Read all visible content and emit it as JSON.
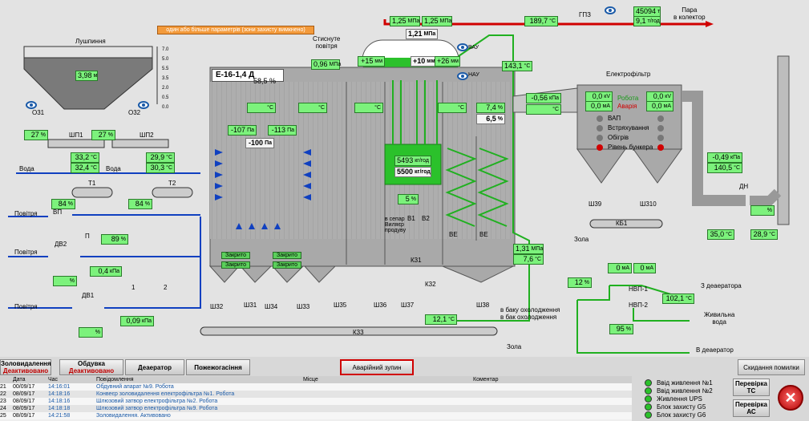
{
  "alerts": {
    "param_warning": "один або більше параметрів (зони захисту вимкнено)"
  },
  "header": {
    "steam_out": "Пара\nв колектор",
    "gpz": "ГПЗ",
    "compressed_air": "Стиснуте\nповітря",
    "electrofilter": "Електрофільтр",
    "husk": "Лушпиння",
    "boiler_name": "Е-16-1,4 Д"
  },
  "values": {
    "p_top1": {
      "v": "1,25",
      "u": "МПа"
    },
    "p_top2": {
      "v": "1,25",
      "u": "МПа"
    },
    "t_top": {
      "v": "189,7",
      "u": "°C"
    },
    "drum_p": {
      "v": "1,21",
      "u": "МПа"
    },
    "flow1": {
      "v": "45094",
      "u": "т"
    },
    "flow2": {
      "v": "9,1",
      "u": "т/год"
    },
    "air_p": {
      "v": "0,96",
      "u": "МПа"
    },
    "hopper_lvl": {
      "v": "3,98",
      "u": "м"
    },
    "drum_left": {
      "v": "+15",
      "u": "мм"
    },
    "drum_mid": {
      "v": "+10",
      "u": "мм"
    },
    "drum_right": {
      "v": "+26",
      "u": "мм"
    },
    "t_143": {
      "v": "143,1",
      "u": "°C"
    },
    "boiler_pct": {
      "v": "58,5",
      "u": "%"
    },
    "furnace_t1": {
      "v": "",
      "u": "°C"
    },
    "furnace_t2": {
      "v": "",
      "u": "°C"
    },
    "furnace_t3": {
      "v": "",
      "u": "°C"
    },
    "furnace_t4": {
      "v": "",
      "u": "°C"
    },
    "o2": {
      "v": "7,4",
      "u": "%"
    },
    "co2": {
      "v": "6,5",
      "u": "%"
    },
    "draft1": {
      "v": "-107",
      "u": "Па"
    },
    "draft2": {
      "v": "-113",
      "u": "Па"
    },
    "draft3": {
      "v": "-100",
      "u": "Па"
    },
    "ef_p": {
      "v": "-0,56",
      "u": "кПа"
    },
    "ef_t": {
      "v": "",
      "u": "°C"
    },
    "ef1_kv": {
      "v": "0,0",
      "u": "кV"
    },
    "ef1_ma": {
      "v": "0,0",
      "u": "мА"
    },
    "ef2_kv": {
      "v": "0,0",
      "u": "кV"
    },
    "ef2_ma": {
      "v": "0,0",
      "u": "мА"
    },
    "dn_p": {
      "v": "-0,49",
      "u": "кПа"
    },
    "dn_t": {
      "v": "140,5",
      "u": "°C"
    },
    "sp1_a": {
      "v": "27",
      "u": "%"
    },
    "sp1_b": {
      "v": "33,2",
      "u": "°C"
    },
    "sp1_c": {
      "v": "32,4",
      "u": "°C"
    },
    "sp2_a": {
      "v": "27",
      "u": "%"
    },
    "sp2_b": {
      "v": "29,9",
      "u": "°C"
    },
    "sp2_c": {
      "v": "30,3",
      "u": "°C"
    },
    "t1_pct": {
      "v": "84",
      "u": "%"
    },
    "t2_pct": {
      "v": "84",
      "u": "%"
    },
    "p_pct": {
      "v": "89",
      "u": "%"
    },
    "dv2_p": {
      "v": "0,4",
      "u": "кПа"
    },
    "dv2_pct": {
      "v": "",
      "u": "%"
    },
    "dv1_pct": {
      "v": "",
      "u": "%"
    },
    "dv1_p": {
      "v": "0,09",
      "u": "кПа"
    },
    "eco_flow1": {
      "v": "5493",
      "u": "кг/год"
    },
    "eco_flow2": {
      "v": "5500",
      "u": "кг/год"
    },
    "sep_pct": {
      "v": "5",
      "u": "%"
    },
    "p_131": {
      "v": "1,31",
      "u": "МПа"
    },
    "t_76": {
      "v": "7,6",
      "u": "°C"
    },
    "k_121": {
      "v": "12,1",
      "u": "°C"
    },
    "nvp_pct": {
      "v": "12",
      "u": "%"
    },
    "nvp_ma1": {
      "v": "0",
      "u": "мА"
    },
    "nvp_ma2": {
      "v": "0",
      "u": "мА"
    },
    "feed_t": {
      "v": "102,1",
      "u": "°C"
    },
    "nvp_95": {
      "v": "95",
      "u": "%"
    },
    "dn_35": {
      "v": "35,0",
      "u": "°C"
    },
    "dn_289": {
      "v": "28,9",
      "u": "°C"
    },
    "dn_pct": {
      "v": "",
      "u": "%"
    }
  },
  "labels": {
    "o31": "О31",
    "o32": "О32",
    "shp1": "ШП1",
    "shp2": "ШП2",
    "voda1": "Вода",
    "voda2": "Вода",
    "t1": "Т1",
    "t2": "Т2",
    "povitrya1": "Повітря",
    "vp": "ВП",
    "p": "П",
    "dv2": "ДВ2",
    "povitrya2": "Повітря",
    "dv1": "ДВ1",
    "povitrya3": "Повітря",
    "n1": "1",
    "n2": "2",
    "vap": "ВАП",
    "vstr": "Встряхування",
    "obig": "Обігрів",
    "riven": "Рівень бункера",
    "robota": "Робота",
    "avariya": "Аварія",
    "vau": "ВАУ",
    "nau": "НАУ",
    "ve1": "ВЕ",
    "ve2": "ВЕ",
    "sh39": "Ш39",
    "sh310": "Ш310",
    "kb1": "КБ1",
    "zola1": "Зола",
    "dn": "ДН",
    "b1": "В1",
    "b2": "В2",
    "k31": "К31",
    "k32": "К32",
    "k33": "К33",
    "sep": "в сепар\nВиляєр\nпродуву",
    "to_tank": "в баку охолодження\nв бак охолодження",
    "nvp1": "НВП-1",
    "nvp2": "НВП-2",
    "to_deaer": "З деаератора",
    "feed": "Живильна\nвода",
    "to_deaer2": "В деаератор",
    "zola2": "Зола",
    "sh32": "Ш32",
    "sh31": "Ш31",
    "sh34": "Ш34",
    "sh33": "Ш33",
    "sh35": "Ш35",
    "sh36": "Ш36",
    "sh37": "Ш37",
    "sh38": "Ш38",
    "zakryto1": "Закрито",
    "zakryto2": "Закрито",
    "zakryto3": "Закрито",
    "zakryto4": "Закрито",
    "scale": [
      "7.0",
      "5.0",
      "5.5",
      "3.5",
      "2.0",
      "0.5",
      "0.0"
    ]
  },
  "buttons": {
    "zoloviddal": {
      "label": "Золовидалення",
      "state": "Деактивовано"
    },
    "obduvka": {
      "label": "Обдувка",
      "state": "Деактивовано"
    },
    "deaerator": {
      "label": "Деаератор"
    },
    "pozhezh": {
      "label": "Пожежогасіння"
    },
    "avar": {
      "label": "Аварійний зупин"
    },
    "skydannya": {
      "label": "Скидання помилки"
    },
    "tc": {
      "label": "Перевірка\nТС"
    },
    "ac": {
      "label": "Перевірка\nАС"
    }
  },
  "log": {
    "headers": [
      "Дата",
      "Час",
      "Повідомлення",
      "Місце",
      "Коментар"
    ],
    "rows": [
      [
        "21",
        "00/09/17",
        "14:16:01",
        "Обдувний апарат №9. Робота"
      ],
      [
        "22",
        "08/09/17",
        "14:18:16",
        "Конвеєр золовидалення електрофільтра №1. Робота"
      ],
      [
        "23",
        "08/09/17",
        "14:18:16",
        "Шлюзовий затвор електрофільтра №2. Робота"
      ],
      [
        "24",
        "08/09/17",
        "14:18:18",
        "Шлюзовий затвор електрофільтра №9. Робота"
      ],
      [
        "25",
        "08/09/17",
        "14:21:58",
        "Золовидалення. Активовано"
      ]
    ]
  },
  "indicators": [
    "Ввід живлення №1",
    "Ввід живлення №2",
    "Живлення UPS",
    "Блок захисту G5",
    "Блок захисту G6"
  ],
  "colors": {
    "ok": "#7cf27c",
    "pipe_red": "#d00000",
    "pipe_green": "#20b020",
    "pipe_blue": "#1040c0"
  }
}
